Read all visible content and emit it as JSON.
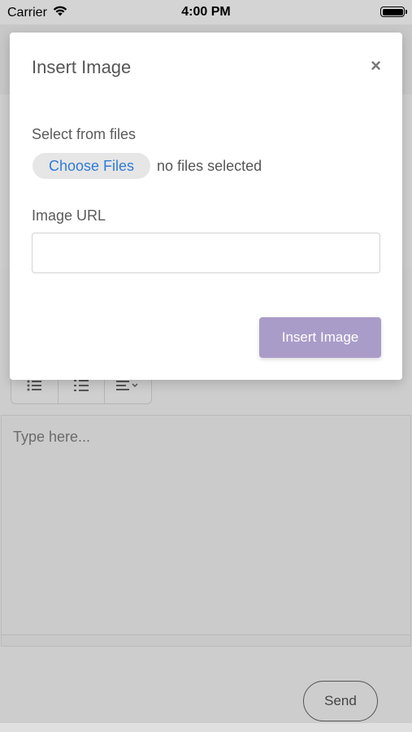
{
  "status_bar": {
    "carrier": "Carrier",
    "time": "4:00 PM"
  },
  "modal": {
    "title": "Insert Image",
    "close_label": "×",
    "files_label": "Select from files",
    "choose_button": "Choose Files",
    "no_files_text": "no files selected",
    "url_label": "Image URL",
    "url_value": "",
    "insert_button": "Insert Image"
  },
  "editor": {
    "placeholder": "Type here..."
  },
  "send_button": "Send",
  "toolbar_icons": [
    "bulleted-list-icon",
    "numbered-list-icon",
    "align-dropdown-icon"
  ],
  "colors": {
    "accent": "#aa9cc9",
    "link": "#2f7bd6",
    "overlay": "#cdcdcd"
  }
}
